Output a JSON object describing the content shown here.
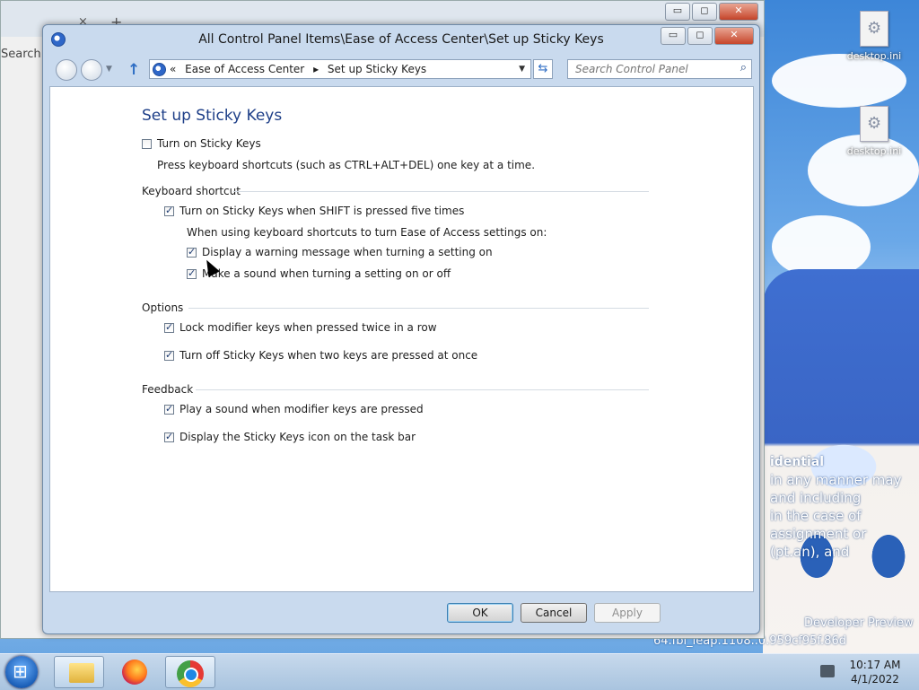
{
  "window": {
    "title": "All Control Panel Items\\Ease of Access Center\\Set up Sticky Keys",
    "minimize": "▭",
    "maximize": "◻",
    "close": "✕"
  },
  "background_window": {
    "search_text": "Search",
    "tab_close": "×",
    "new_tab": "+"
  },
  "navigation": {
    "back_icon": "back-arrow-icon",
    "forward_icon": "forward-arrow-icon",
    "up_icon": "↑",
    "chevrons": "«",
    "breadcrumb": [
      "Ease of Access Center",
      "Set up Sticky Keys"
    ],
    "separator": "▸",
    "dropdown": "▼",
    "refresh": "⇆",
    "search_placeholder": "Search Control Panel",
    "search_icon": "⌕"
  },
  "page": {
    "title": "Set up Sticky Keys",
    "turn_on": {
      "label": "Turn on Sticky Keys",
      "checked": false
    },
    "turn_on_desc": "Press keyboard shortcuts (such as CTRL+ALT+DEL) one key at a time.",
    "keyboard_shortcut": {
      "heading": "Keyboard shortcut",
      "shift_five": {
        "label": "Turn on Sticky Keys when SHIFT is pressed five times",
        "checked": true
      },
      "subheading": "When using keyboard shortcuts to turn Ease of Access settings on:",
      "warning": {
        "label": "Display a warning message when turning a setting on",
        "checked": true
      },
      "sound": {
        "label": "Make a sound when turning a setting on or off",
        "checked": true
      }
    },
    "options": {
      "heading": "Options",
      "lock_modifier": {
        "label": "Lock modifier keys when pressed twice in a row",
        "checked": true
      },
      "turn_off_two": {
        "label": "Turn off Sticky Keys when two keys are pressed at once",
        "checked": true
      }
    },
    "feedback": {
      "heading": "Feedback",
      "play_sound": {
        "label": "Play a sound when modifier keys are pressed",
        "checked": true
      },
      "taskbar_icon": {
        "label": "Display the Sticky Keys icon on the task bar",
        "checked": true
      }
    }
  },
  "buttons": {
    "ok": "OK",
    "cancel": "Cancel",
    "apply": "Apply"
  },
  "desktop": {
    "icons": [
      "desktop.ini",
      "desktop.ini"
    ],
    "overlay_lines": [
      "idential",
      "in any manner may",
      "and including",
      "in the case of",
      "assignment or",
      "(pt.an), and"
    ],
    "build_line_1": "Developer Preview",
    "build_line_2": "64.fbl_leap.1108..0.959cf95f.86d"
  },
  "taskbar": {
    "apps": [
      "folder-icon",
      "firefox-icon",
      "chrome-icon"
    ],
    "time": "10:17 AM",
    "date": "4/1/2022"
  },
  "colors": {
    "title_blue": "#1e3f88",
    "window_frame": "#c9daee",
    "close_red": "#c7452a"
  }
}
